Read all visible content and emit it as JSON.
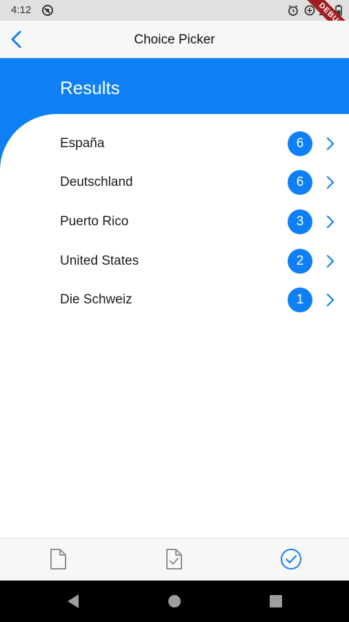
{
  "status_bar": {
    "time": "4:12",
    "debug_label": "DEBUG"
  },
  "nav": {
    "title": "Choice Picker",
    "back_icon": "chevron-left-icon"
  },
  "header": {
    "title": "Results"
  },
  "results": [
    {
      "label": "España",
      "count": "6"
    },
    {
      "label": "Deutschland",
      "count": "6"
    },
    {
      "label": "Puerto Rico",
      "count": "3"
    },
    {
      "label": "United States",
      "count": "2"
    },
    {
      "label": "Die Schweiz",
      "count": "1"
    }
  ],
  "tabs": [
    {
      "icon": "document-icon",
      "active": false
    },
    {
      "icon": "document-check-icon",
      "active": false
    },
    {
      "icon": "check-circle-icon",
      "active": true
    }
  ],
  "colors": {
    "accent": "#0f7ff5",
    "inactive_icon": "#8e8e8e",
    "status_bar": "#e0e0e0",
    "debug_ribbon": "#a31e22"
  }
}
